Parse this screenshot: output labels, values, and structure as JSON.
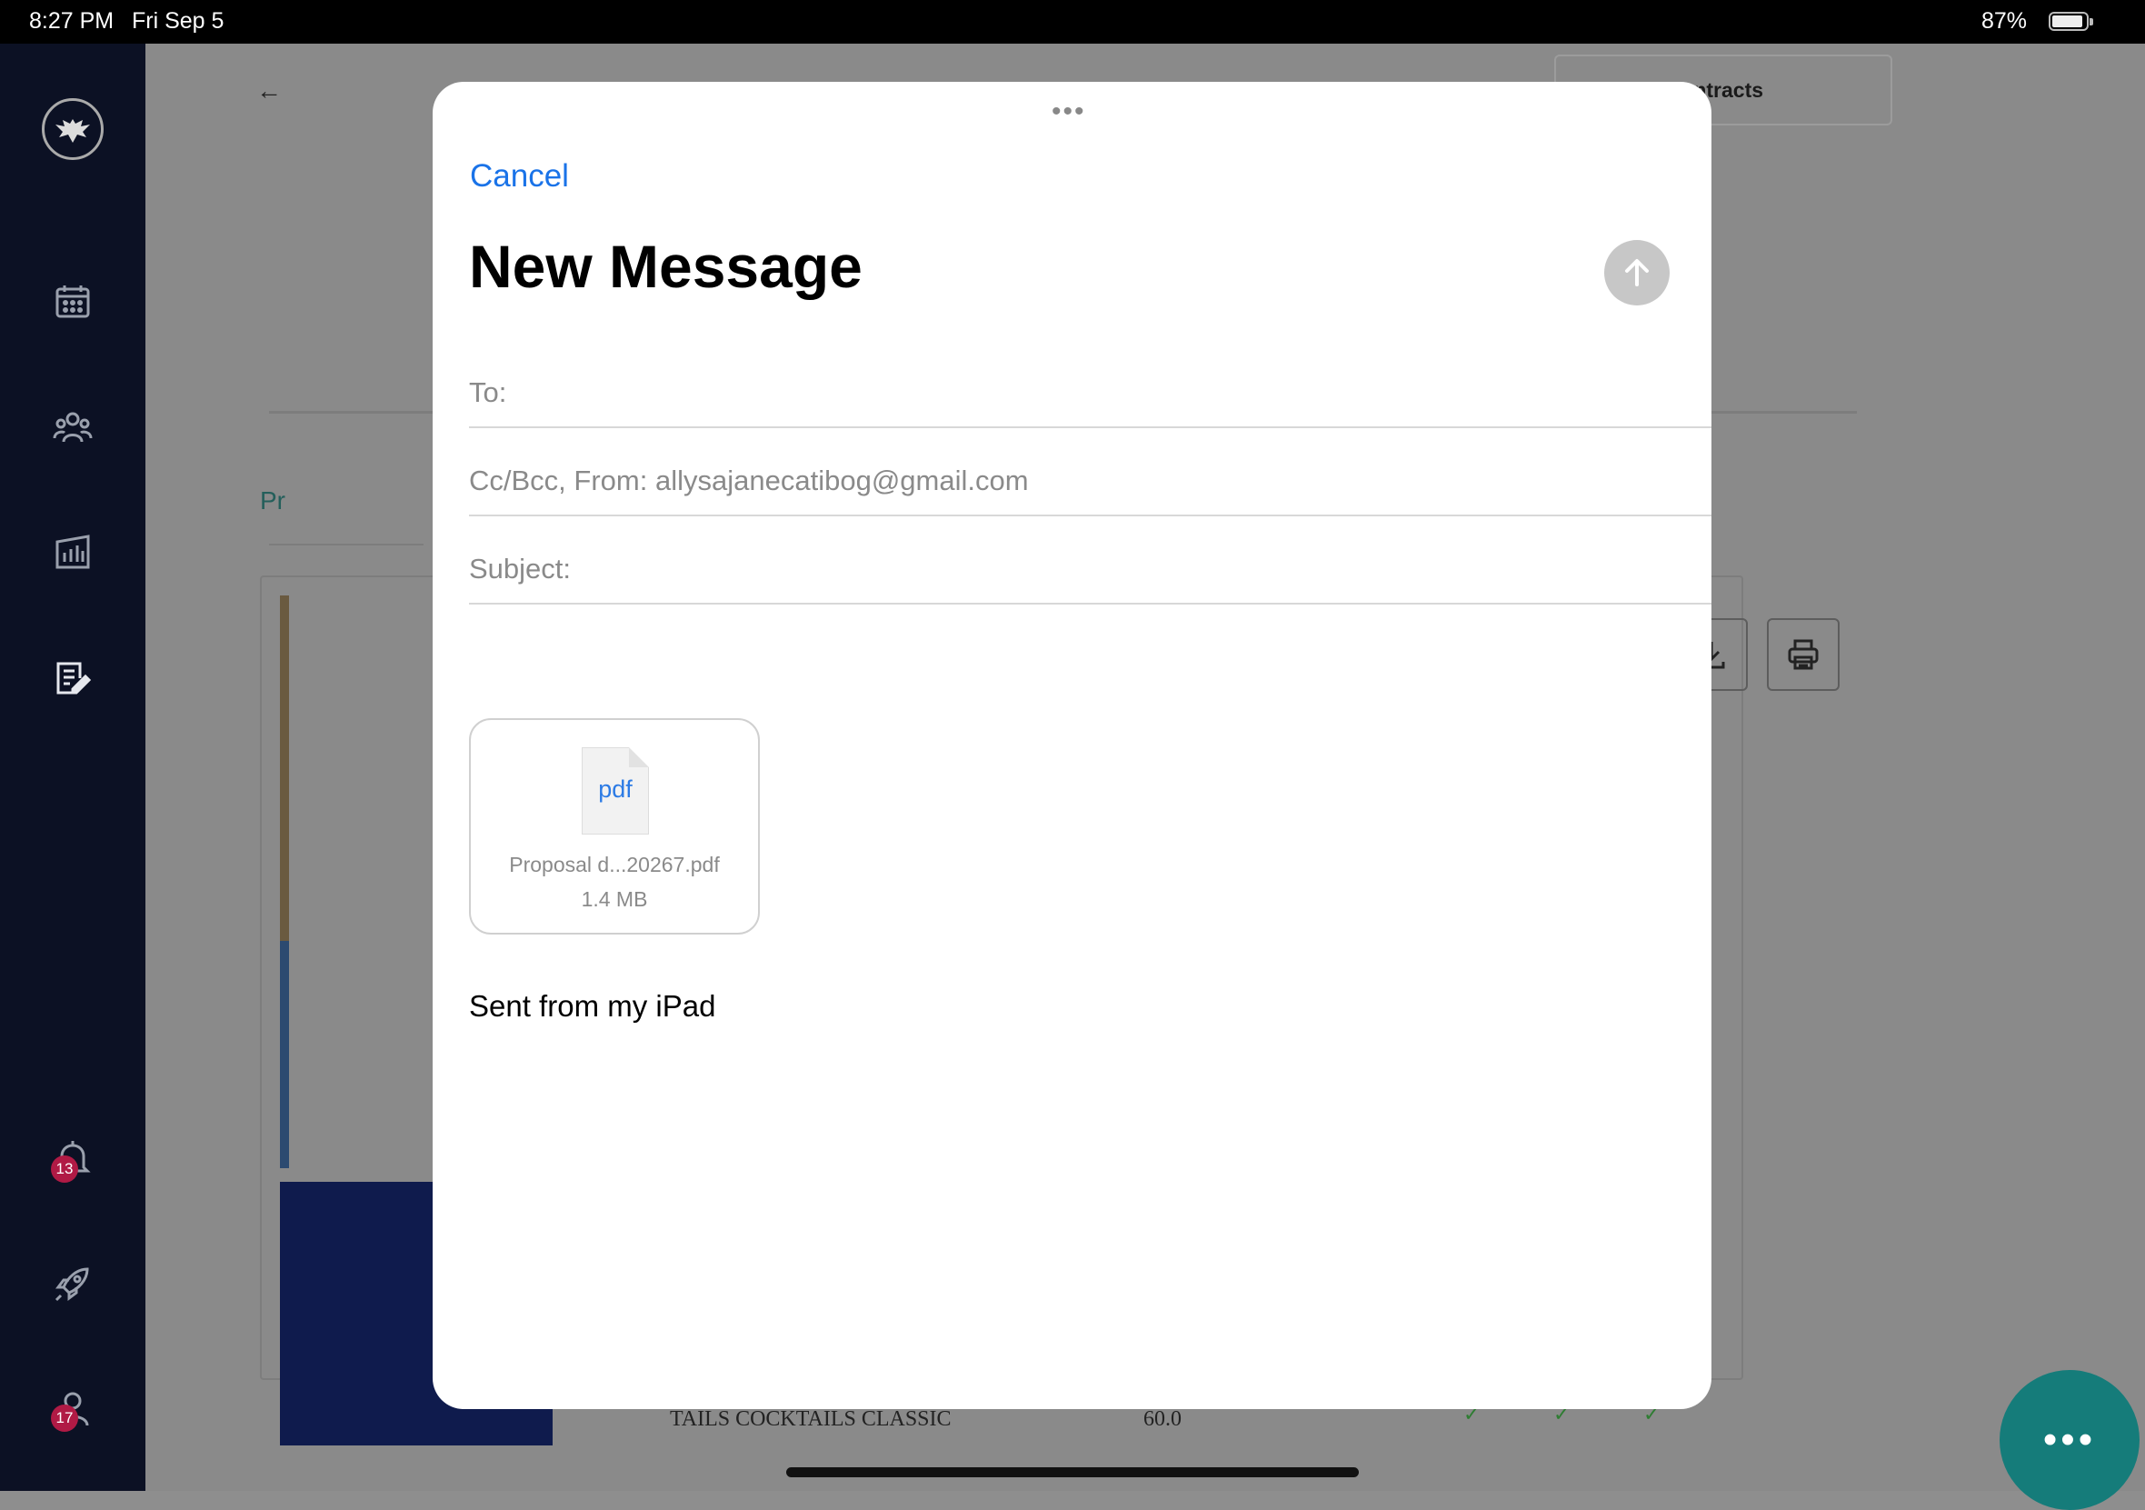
{
  "status_bar": {
    "time": "8:27 PM",
    "date": "Fri Sep 5",
    "battery": "87%"
  },
  "sidebar": {
    "items": [
      "calendar",
      "team",
      "reports",
      "contracts",
      "notifications",
      "launch",
      "profile"
    ],
    "notifications_badge": "13",
    "profile_badge": "17"
  },
  "background": {
    "select_label": "on contracts",
    "tab_label": "Pr",
    "row_text": "TAILS COCKTAILS CLASSIC",
    "row_value": "60.0"
  },
  "compose": {
    "cancel_label": "Cancel",
    "title": "New Message",
    "to_label": "To:",
    "ccbcc_label": "Cc/Bcc, From:",
    "from_value": "allysajanecatibog@gmail.com",
    "subject_label": "Subject:",
    "attachment": {
      "type_label": "pdf",
      "name": "Proposal d...20267.pdf",
      "size": "1.4 MB"
    },
    "signature": "Sent from my iPad"
  },
  "colors": {
    "accent": "#1a73e8",
    "sidebar": "#0c1124",
    "badge": "#b01a45",
    "fab": "#157c7a"
  }
}
